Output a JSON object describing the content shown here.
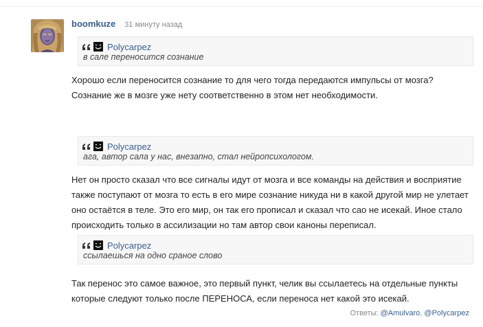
{
  "comment": {
    "username": "boomkuze",
    "timestamp": "31 минуту назад",
    "blocks": [
      {
        "type": "quote",
        "author": "Polycarpez",
        "text": "в сале переносится сознание"
      },
      {
        "type": "para",
        "lines": [
          "Хорошо если переносится сознание то для чего тогда передаются импульсы от мозга?",
          "Сознание же в мозге уже нету соответственно в этом нет необходимости."
        ]
      },
      {
        "type": "quote",
        "author": "Polycarpez",
        "text": "ага, автор сала у нас, внезапно, стал нейропсихологом."
      },
      {
        "type": "para",
        "lines": [
          "Нет он просто сказал что все сигналы идут от мозга и все команды на действия и восприятие",
          "также поступают от мозга то есть в его мире сознание никуда ни в какой другой мир не улетает",
          "оно остаётся в теле. Это его мир, он так его прописал и сказал что сао не исекай. Иное стало",
          "происходить только в ассилизации но там автор свои каноны переписал."
        ]
      },
      {
        "type": "quote",
        "author": "Polycarpez",
        "text": "ссылаешься на одно сраное слово"
      },
      {
        "type": "para",
        "lines": [
          "Так перенос это самое важное, это первый пункт, челик вы ссылаетесь на отдельные пункты",
          "которые следуют только после ПЕРЕНОСА, если переноса нет какой это исекай."
        ]
      }
    ],
    "replies_label": "Ответы:",
    "replies": [
      "@Amulvaro",
      "@Polycarpez"
    ],
    "reply_separator": ","
  },
  "colors": {
    "link": "#3a5f8f",
    "quote_bg": "#f7f7f7",
    "muted": "#888888"
  },
  "icons": {
    "quote": "quote-mark-icon",
    "avatar": "user-avatar",
    "quote_avatar": "quote-author-avatar-icon"
  }
}
